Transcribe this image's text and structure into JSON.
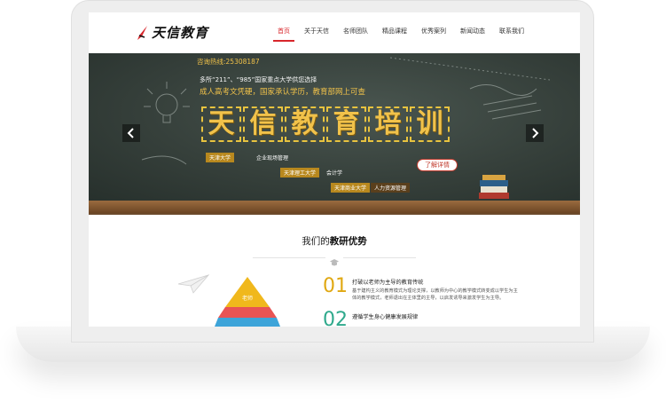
{
  "logo": {
    "text": "天信教育"
  },
  "nav": {
    "items": [
      "首页",
      "关于天信",
      "名师团队",
      "精品课程",
      "优秀案列",
      "新闻动态",
      "联系我们"
    ],
    "active_index": 0
  },
  "banner": {
    "hotline": "咨询热线:25308187",
    "intro_line1": "多所“211”、“985”国家重点大学供您选择",
    "intro_line2": "成人高考文凭硬，国家承认学历，教育部网上可查",
    "title_chars": [
      "天",
      "信",
      "教",
      "育",
      "培",
      "训"
    ],
    "tags": [
      {
        "school": "天津大学",
        "major": "企业现场管理"
      },
      {
        "school": "天津理工大学",
        "major": "会计学"
      },
      {
        "school": "天津商业大学",
        "major": "人力资源管理"
      }
    ],
    "detail_button": "了解详情"
  },
  "section": {
    "title_prefix": "我们的",
    "title_highlight": "教研优势",
    "pyramid_label": "老师",
    "items": [
      {
        "number": "01",
        "heading": "打破以老师为主导的教育传统",
        "desc": "基于建构主义的教育模式为理论支撑，以教师为中心的教学模式转变成以学生为主体的教学模式，老师退出在主体里的主导，以启发诱导来激发学生为主导。"
      },
      {
        "number": "02",
        "heading": "遵循学生身心健康发展规律"
      }
    ]
  },
  "colors": {
    "accent": "#d8262b",
    "chalk_yellow": "#f1c24a",
    "number_gold": "#e0a812",
    "number_teal": "#2fa98c"
  }
}
